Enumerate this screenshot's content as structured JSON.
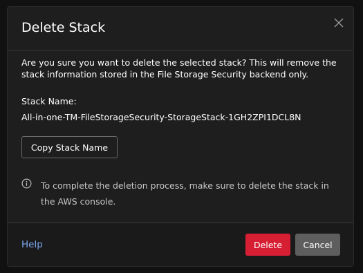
{
  "dialog": {
    "title": "Delete Stack",
    "close_icon": "close-icon",
    "question": "Are you sure you want to delete the selected stack? This will remove the stack information stored in the File Storage Security backend only.",
    "stack_name_label": "Stack Name:",
    "stack_name_value": "All-in-one-TM-FileStorageSecurity-StorageStack-1GH2ZPI1DCL8N",
    "copy_button_label": "Copy Stack Name",
    "info_icon": "info-icon",
    "info_text": "To complete the deletion process, make sure to delete the stack in the AWS console."
  },
  "footer": {
    "help_label": "Help",
    "delete_label": "Delete",
    "cancel_label": "Cancel"
  },
  "colors": {
    "background": "#111111",
    "dialog": "#1e1e1e",
    "delete": "#d71f33",
    "cancel": "#5e5e5e",
    "link": "#7aa7ee"
  }
}
